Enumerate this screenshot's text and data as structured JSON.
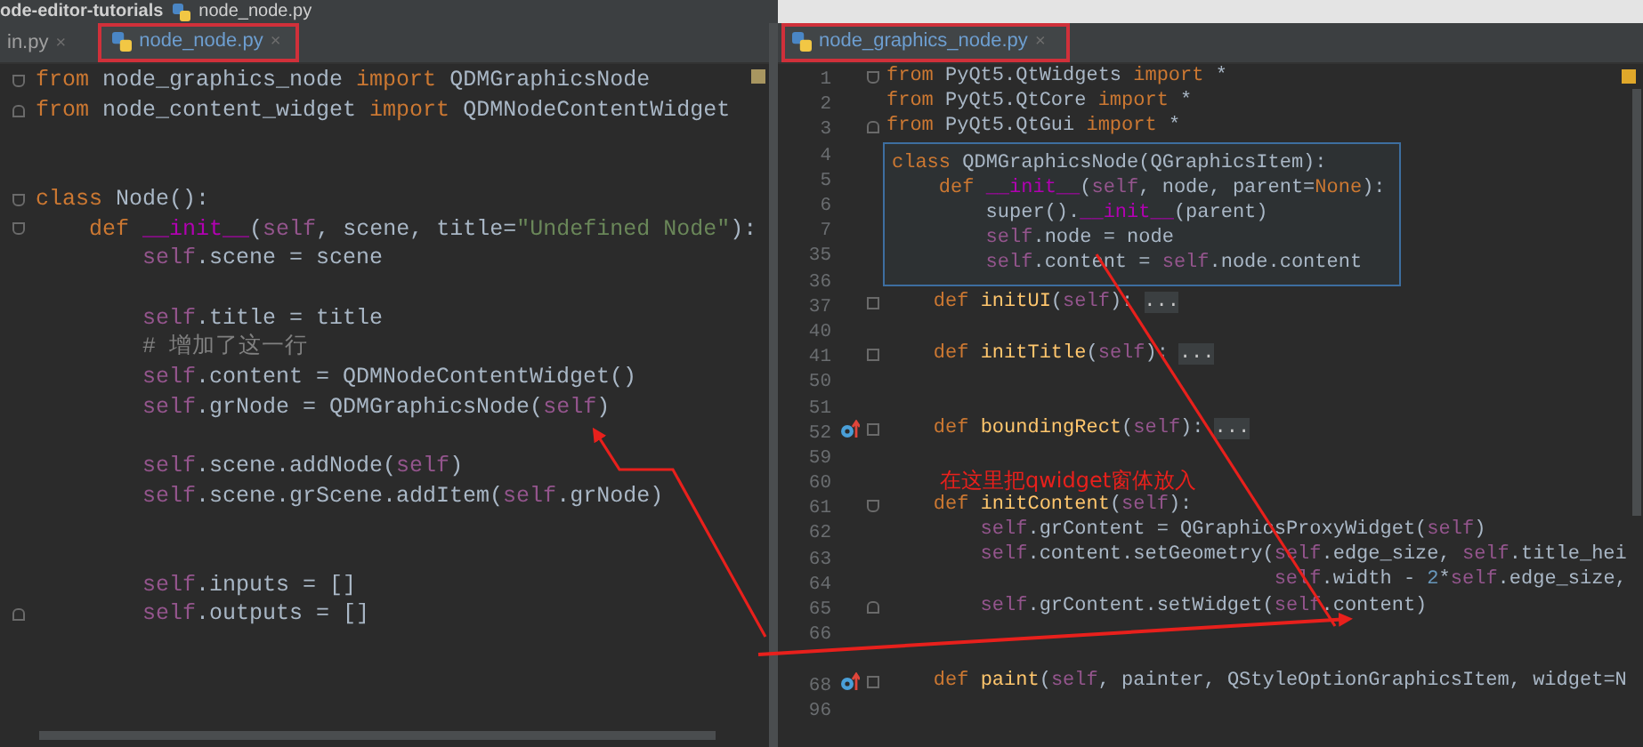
{
  "breadcrumb": {
    "project": "ode-editor-tutorials",
    "file": "node_node.py"
  },
  "left_pane": {
    "tabs": [
      {
        "label": "in.py",
        "close": "×",
        "selected": false
      },
      {
        "label": "node_node.py",
        "close": "×",
        "selected": true
      }
    ],
    "lines": [
      {
        "kind": "fold-start",
        "tokens": [
          {
            "kind": "kw",
            "t": "from"
          },
          {
            "kind": "p",
            "t": " node_graphics_node "
          },
          {
            "kind": "kw",
            "t": "import"
          },
          {
            "kind": "p",
            "t": " QDMGraphicsNode"
          }
        ]
      },
      {
        "kind": "fold-end",
        "tokens": [
          {
            "kind": "kw",
            "t": "from"
          },
          {
            "kind": "p",
            "t": " node_content_widget "
          },
          {
            "kind": "kw",
            "t": "import"
          },
          {
            "kind": "p",
            "t": " QDMNodeContentWidget"
          }
        ]
      },
      {
        "kind": "blank"
      },
      {
        "kind": "blank"
      },
      {
        "kind": "fold-start",
        "tokens": [
          {
            "kind": "kw",
            "t": "class"
          },
          {
            "kind": "p",
            "t": " Node():"
          }
        ]
      },
      {
        "kind": "fold-start",
        "tokens": [
          {
            "kind": "kw",
            "t": "    def "
          },
          {
            "kind": "d",
            "t": "__init__"
          },
          {
            "kind": "p",
            "t": "("
          },
          {
            "kind": "s",
            "t": "self"
          },
          {
            "kind": "p",
            "t": ", scene, title="
          },
          {
            "kind": "str",
            "t": "\"Undefined Node\""
          },
          {
            "kind": "p",
            "t": "):"
          }
        ]
      },
      {
        "kind": "code",
        "tokens": [
          {
            "kind": "s",
            "t": "        self"
          },
          {
            "kind": "p",
            "t": ".scene = scene"
          }
        ]
      },
      {
        "kind": "blank"
      },
      {
        "kind": "code",
        "tokens": [
          {
            "kind": "s",
            "t": "        self"
          },
          {
            "kind": "p",
            "t": ".title = title"
          }
        ]
      },
      {
        "kind": "code",
        "tokens": [
          {
            "kind": "c",
            "t": "        # 增加了这一行"
          }
        ]
      },
      {
        "kind": "code",
        "tokens": [
          {
            "kind": "s",
            "t": "        self"
          },
          {
            "kind": "p",
            "t": ".content = QDMNodeContentWidget()"
          }
        ]
      },
      {
        "kind": "code",
        "tokens": [
          {
            "kind": "s",
            "t": "        self"
          },
          {
            "kind": "p",
            "t": ".grNode = QDMGraphicsNode("
          },
          {
            "kind": "s",
            "t": "self"
          },
          {
            "kind": "p",
            "t": ")"
          }
        ]
      },
      {
        "kind": "blank"
      },
      {
        "kind": "code",
        "tokens": [
          {
            "kind": "s",
            "t": "        self"
          },
          {
            "kind": "p",
            "t": ".scene.addNode("
          },
          {
            "kind": "s",
            "t": "self"
          },
          {
            "kind": "p",
            "t": ")"
          }
        ]
      },
      {
        "kind": "code",
        "tokens": [
          {
            "kind": "s",
            "t": "        self"
          },
          {
            "kind": "p",
            "t": ".scene.grScene.addItem("
          },
          {
            "kind": "s",
            "t": "self"
          },
          {
            "kind": "p",
            "t": ".grNode)"
          }
        ]
      },
      {
        "kind": "blank"
      },
      {
        "kind": "blank"
      },
      {
        "kind": "code",
        "tokens": [
          {
            "kind": "s",
            "t": "        self"
          },
          {
            "kind": "p",
            "t": ".inputs = []"
          }
        ]
      },
      {
        "kind": "fold-end",
        "tokens": [
          {
            "kind": "s",
            "t": "        self"
          },
          {
            "kind": "p",
            "t": ".outputs = []"
          }
        ]
      }
    ]
  },
  "right_pane": {
    "tabs": [
      {
        "label": "node_graphics_node.py",
        "close": "×",
        "selected": true
      }
    ],
    "lines": [
      {
        "number": "1",
        "kind": "fold-start",
        "tokens": [
          {
            "kind": "kw",
            "t": "from"
          },
          {
            "kind": "p",
            "t": " PyQt5.QtWidgets "
          },
          {
            "kind": "kw",
            "t": "import"
          },
          {
            "kind": "p",
            "t": " *"
          }
        ]
      },
      {
        "number": "2",
        "kind": "code",
        "tokens": [
          {
            "kind": "kw",
            "t": "from"
          },
          {
            "kind": "p",
            "t": " PyQt5.QtCore "
          },
          {
            "kind": "kw",
            "t": "import"
          },
          {
            "kind": "p",
            "t": " *"
          }
        ]
      },
      {
        "number": "3",
        "kind": "fold-end",
        "tokens": [
          {
            "kind": "kw",
            "t": "from"
          },
          {
            "kind": "p",
            "t": " PyQt5.QtGui "
          },
          {
            "kind": "kw",
            "t": "import"
          },
          {
            "kind": "p",
            "t": " *"
          }
        ]
      },
      {
        "number": "4",
        "kind": "blank"
      },
      {
        "number": "5",
        "kind": "blank"
      },
      {
        "number": "6",
        "kind": "blank"
      },
      {
        "number": "7",
        "kind": "blank"
      },
      {
        "number": "35",
        "kind": "blank"
      },
      {
        "number": "36",
        "kind": "blank"
      },
      {
        "number": "37",
        "kind": "folded",
        "tokens": [
          {
            "kind": "kw",
            "t": "    def "
          },
          {
            "kind": "fn",
            "t": "initUI"
          },
          {
            "kind": "p",
            "t": "("
          },
          {
            "kind": "s",
            "t": "self"
          },
          {
            "kind": "p",
            "t": "):"
          },
          {
            "kind": "fold",
            "t": "..."
          }
        ]
      },
      {
        "number": "40",
        "kind": "blank"
      },
      {
        "number": "41",
        "kind": "folded",
        "tokens": [
          {
            "kind": "kw",
            "t": "    def "
          },
          {
            "kind": "fn",
            "t": "initTitle"
          },
          {
            "kind": "p",
            "t": "("
          },
          {
            "kind": "s",
            "t": "self"
          },
          {
            "kind": "p",
            "t": "):"
          },
          {
            "kind": "fold",
            "t": "..."
          }
        ]
      },
      {
        "number": "50",
        "kind": "blank"
      },
      {
        "number": "51",
        "kind": "blank"
      },
      {
        "number": "52",
        "kind": "folded-override",
        "tokens": [
          {
            "kind": "kw",
            "t": "    def "
          },
          {
            "kind": "fn",
            "t": "boundingRect"
          },
          {
            "kind": "p",
            "t": "("
          },
          {
            "kind": "s",
            "t": "self"
          },
          {
            "kind": "p",
            "t": "):"
          },
          {
            "kind": "fold",
            "t": "..."
          }
        ]
      },
      {
        "number": "59",
        "kind": "blank"
      },
      {
        "number": "60",
        "kind": "blank"
      },
      {
        "number": "61",
        "kind": "fold-start",
        "tokens": [
          {
            "kind": "kw",
            "t": "    def "
          },
          {
            "kind": "fn",
            "t": "initContent"
          },
          {
            "kind": "p",
            "t": "("
          },
          {
            "kind": "s",
            "t": "self"
          },
          {
            "kind": "p",
            "t": "):"
          }
        ]
      },
      {
        "number": "62",
        "kind": "code",
        "tokens": [
          {
            "kind": "s",
            "t": "        self"
          },
          {
            "kind": "p",
            "t": ".grContent = QGraphicsProxyWidget("
          },
          {
            "kind": "s",
            "t": "self"
          },
          {
            "kind": "p",
            "t": ")"
          }
        ]
      },
      {
        "number": "63",
        "kind": "code",
        "tokens": [
          {
            "kind": "s",
            "t": "        self"
          },
          {
            "kind": "p",
            "t": ".content.setGeometry("
          },
          {
            "kind": "s",
            "t": "self"
          },
          {
            "kind": "p",
            "t": ".edge_size, "
          },
          {
            "kind": "s",
            "t": "self"
          },
          {
            "kind": "p",
            "t": ".title_hei"
          }
        ]
      },
      {
        "number": "64",
        "kind": "code",
        "tokens": [
          {
            "kind": "s",
            "t": "                                 self"
          },
          {
            "kind": "p",
            "t": ".width - "
          },
          {
            "kind": "num",
            "t": "2"
          },
          {
            "kind": "p",
            "t": "*"
          },
          {
            "kind": "s",
            "t": "self"
          },
          {
            "kind": "p",
            "t": ".edge_size,"
          }
        ]
      },
      {
        "number": "65",
        "kind": "fold-end",
        "tokens": [
          {
            "kind": "s",
            "t": "        self"
          },
          {
            "kind": "p",
            "t": ".grContent.setWidget("
          },
          {
            "kind": "s",
            "t": "self"
          },
          {
            "kind": "p",
            "t": ".content)"
          }
        ]
      },
      {
        "number": "66",
        "kind": "blank"
      },
      {
        "kind": "blank"
      },
      {
        "number": "68",
        "kind": "folded-override",
        "tokens": [
          {
            "kind": "kw",
            "t": "    def "
          },
          {
            "kind": "fn",
            "t": "paint"
          },
          {
            "kind": "p",
            "t": "("
          },
          {
            "kind": "s",
            "t": "self"
          },
          {
            "kind": "p",
            "t": ", painter, QStyleOptionGraphicsItem, widget=N"
          }
        ]
      },
      {
        "number": "96",
        "kind": "blank"
      }
    ],
    "popup": {
      "lines": [
        {
          "tokens": [
            {
              "kind": "kw",
              "t": "class"
            },
            {
              "kind": "p",
              "t": " QDMGraphicsNode(QGraphicsItem):"
            }
          ]
        },
        {
          "tokens": [
            {
              "kind": "kw",
              "t": "    def "
            },
            {
              "kind": "d",
              "t": "__init__"
            },
            {
              "kind": "p",
              "t": "("
            },
            {
              "kind": "s",
              "t": "self"
            },
            {
              "kind": "p",
              "t": ", node, parent="
            },
            {
              "kind": "kw",
              "t": "None"
            },
            {
              "kind": "p",
              "t": "):"
            }
          ]
        },
        {
          "tokens": [
            {
              "kind": "p",
              "t": "        super()."
            },
            {
              "kind": "d",
              "t": "__init__"
            },
            {
              "kind": "p",
              "t": "(parent)"
            }
          ]
        },
        {
          "tokens": [
            {
              "kind": "s",
              "t": "        self"
            },
            {
              "kind": "p",
              "t": ".node = node"
            }
          ]
        },
        {
          "tokens": [
            {
              "kind": "s",
              "t": "        self"
            },
            {
              "kind": "p",
              "t": ".content = "
            },
            {
              "kind": "s",
              "t": "self"
            },
            {
              "kind": "p",
              "t": ".node.content"
            }
          ]
        }
      ]
    }
  },
  "annotation": {
    "text": "在这里把qwidget窗体放入"
  }
}
